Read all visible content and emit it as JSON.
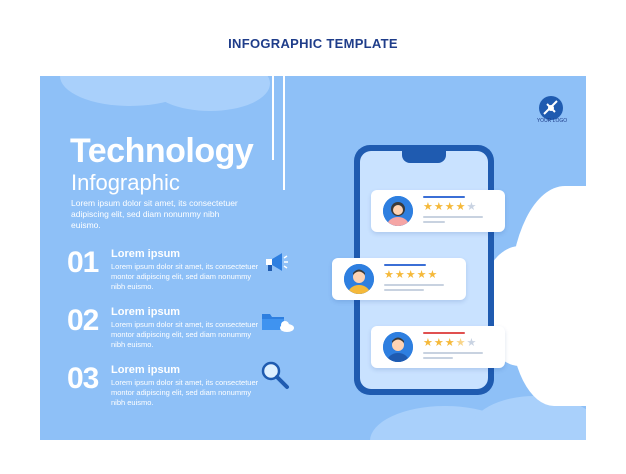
{
  "page": {
    "heading": "INFOGRAPHIC TEMPLATE"
  },
  "logo": {
    "text": "YOUR LOGO",
    "icon": "logo-mark-icon"
  },
  "hero": {
    "title": "Technology",
    "subtitle": "Infographic",
    "intro": "Lorem ipsum dolor sit amet, its consectetuer adipiscing elit, sed diam nonummy nibh euismo."
  },
  "items": [
    {
      "number": "01",
      "title": "Lorem ipsum",
      "body": "Lorem ipsum dolor sit amet, its consectetuer montor adipiscing elit, sed diam nonummy nibh euismo.",
      "icon": "megaphone-icon"
    },
    {
      "number": "02",
      "title": "Lorem ipsum",
      "body": "Lorem ipsum dolor sit amet, its consectetuer montor adipiscing elit, sed diam nonummy nibh euismo.",
      "icon": "folder-cloud-icon"
    },
    {
      "number": "03",
      "title": "Lorem ipsum",
      "body": "Lorem ipsum dolor sit amet, its consectetuer montor adipiscing elit, sed diam nonummy nibh euismo.",
      "icon": "magnifier-icon"
    }
  ],
  "reviews": [
    {
      "avatar": "woman-avatar",
      "rating": 4,
      "max": 5
    },
    {
      "avatar": "man-avatar",
      "rating": 5,
      "max": 5
    },
    {
      "avatar": "man-avatar-2",
      "rating": 3.5,
      "max": 5
    }
  ],
  "colors": {
    "background": "#8ec0f7",
    "accent": "#1f5bb0",
    "star": "#f5b93a",
    "heading": "#1f3d8a"
  }
}
